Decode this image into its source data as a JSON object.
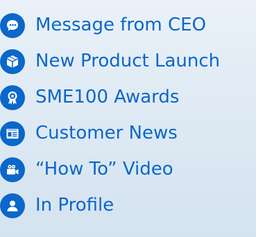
{
  "menu": {
    "items": [
      {
        "label": "Message from CEO",
        "icon": "chat-bubble-icon"
      },
      {
        "label": "New Product Launch",
        "icon": "box-icon"
      },
      {
        "label": "SME100 Awards",
        "icon": "award-ribbon-icon"
      },
      {
        "label": "Customer News",
        "icon": "newspaper-icon"
      },
      {
        "label": "“How To” Video",
        "icon": "video-camera-icon"
      },
      {
        "label": "In Profile",
        "icon": "person-icon"
      }
    ]
  },
  "colors": {
    "accent": "#0b67c9",
    "background": "#e3edf6"
  }
}
